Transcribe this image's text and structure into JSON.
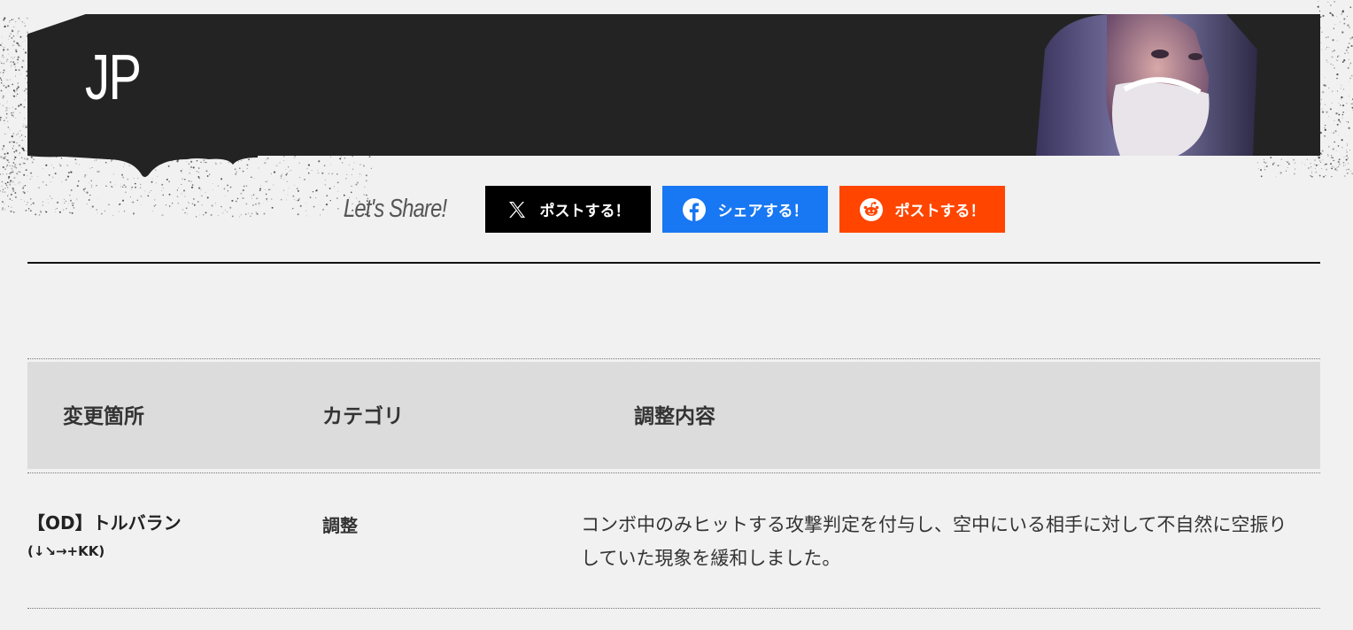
{
  "header": {
    "title": "JP",
    "portrait": "character-portrait"
  },
  "share": {
    "label": "Let's Share!",
    "buttons": [
      {
        "icon": "x-logo-icon",
        "label": "ポストする！",
        "color": "#000000"
      },
      {
        "icon": "facebook-icon",
        "label": "シェアする！",
        "color": "#1877f2"
      },
      {
        "icon": "reddit-icon",
        "label": "ポストする！",
        "color": "#ff4500"
      }
    ]
  },
  "table": {
    "headers": [
      "変更箇所",
      "カテゴリ",
      "調整内容"
    ],
    "rows": [
      {
        "move": "【OD】トルバラン",
        "command": "(↓↘→+KK)",
        "category": "調整",
        "description": "コンボ中のみヒットする攻撃判定を付与し、空中にいる相手に対して不自然に空振りしていた現象を緩和しました。"
      }
    ]
  }
}
